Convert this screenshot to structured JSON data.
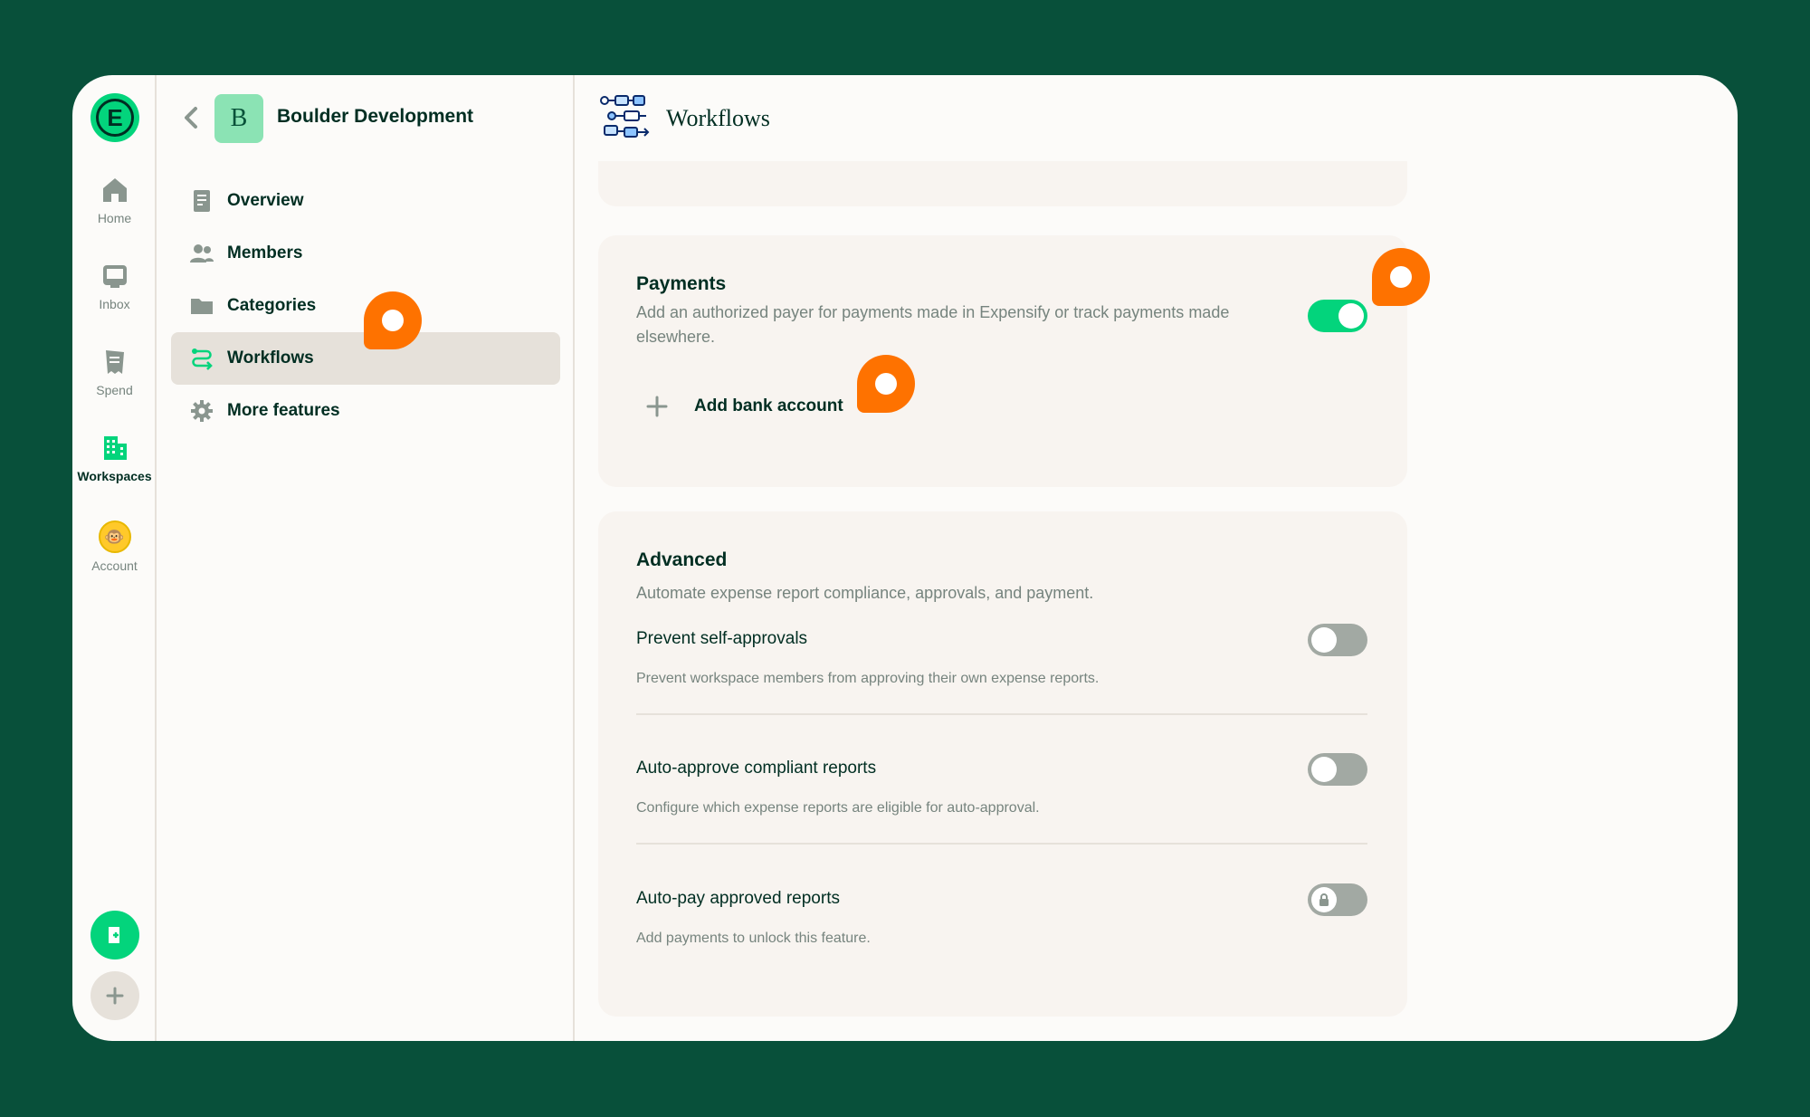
{
  "rail": {
    "logo_letter": "E",
    "items": [
      {
        "label": "Home",
        "icon": "home-icon"
      },
      {
        "label": "Inbox",
        "icon": "inbox-icon"
      },
      {
        "label": "Spend",
        "icon": "receipt-icon"
      },
      {
        "label": "Workspaces",
        "icon": "building-icon"
      },
      {
        "label": "Account",
        "icon": "avatar-icon"
      }
    ]
  },
  "workspace": {
    "initial": "B",
    "name": "Boulder Development",
    "nav": [
      {
        "label": "Overview",
        "icon": "document-icon"
      },
      {
        "label": "Members",
        "icon": "users-icon"
      },
      {
        "label": "Categories",
        "icon": "folder-icon"
      },
      {
        "label": "Workflows",
        "icon": "workflow-icon"
      },
      {
        "label": "More features",
        "icon": "gear-icon"
      }
    ]
  },
  "page": {
    "title": "Workflows",
    "payments": {
      "title": "Payments",
      "description": "Add an authorized payer for payments made in Expensify or track payments made elsewhere.",
      "enabled": true,
      "add_bank_label": "Add bank account"
    },
    "advanced": {
      "title": "Advanced",
      "description": "Automate expense report compliance, approvals, and payment.",
      "rows": [
        {
          "title": "Prevent self-approvals",
          "description": "Prevent workspace members from approving their own expense reports.",
          "enabled": false
        },
        {
          "title": "Auto-approve compliant reports",
          "description": "Configure which expense reports are eligible for auto-approval.",
          "enabled": false
        },
        {
          "title": "Auto-pay approved reports",
          "description": "Add payments to unlock this feature.",
          "enabled": false,
          "locked": true
        }
      ]
    }
  },
  "colors": {
    "background": "#08503a",
    "accent_green": "#03d47c",
    "marker_orange": "#fe7200",
    "text_dark": "#002e22",
    "text_muted": "#76847e"
  }
}
